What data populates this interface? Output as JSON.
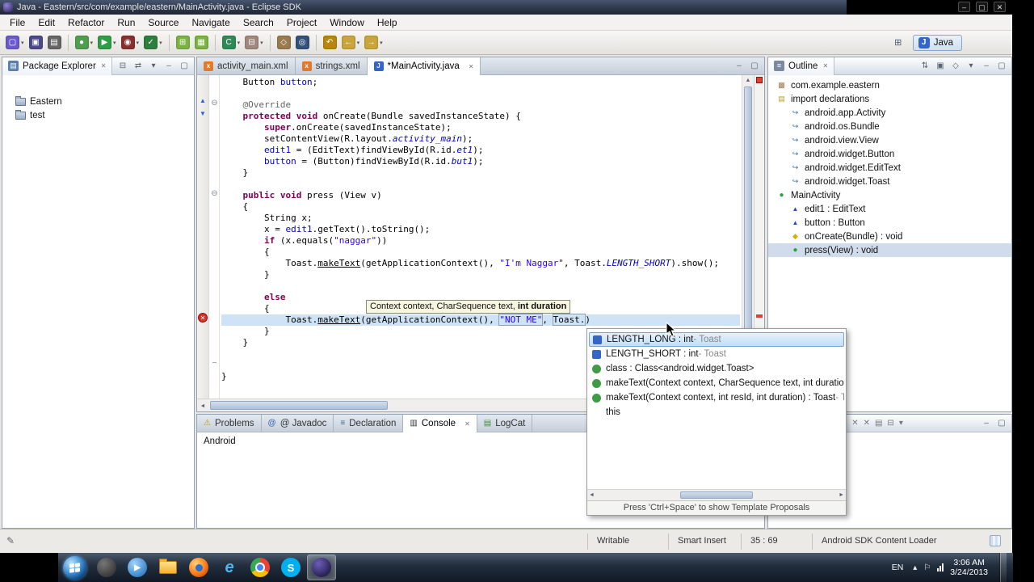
{
  "icons": {
    "minimize": "–",
    "maximize": "▢",
    "close": "✕",
    "view_close": "✕",
    "panel_min": "–",
    "panel_max": "▢",
    "view_menu": "▾",
    "collapse_all": "⊟",
    "link_with_editor": "⇄",
    "sort": "⇅",
    "hide_fields": "▣",
    "hide_static": "◇",
    "fold_collapse": "⊖",
    "fold_end": "−",
    "error": "✕",
    "scroll_left": "◄",
    "scroll_right": "►",
    "scroll_up": "▲",
    "scroll_down": "▼",
    "package_explorer_view": "▤",
    "outline_view": "≡",
    "tray_hidden": "▴",
    "tray_flag": "⚐",
    "pencil": "✎"
  },
  "window": {
    "title": "Java - Eastern/src/com/example/eastern/MainActivity.java - Eclipse SDK"
  },
  "menu_bar": {
    "items": [
      "File",
      "Edit",
      "Refactor",
      "Run",
      "Source",
      "Navigate",
      "Search",
      "Project",
      "Window",
      "Help"
    ]
  },
  "toolbar": {
    "buttons": [
      {
        "name": "new-wizard",
        "glyph": "▢",
        "tint": "#6a5acd",
        "dd": true
      },
      {
        "name": "save",
        "glyph": "▣",
        "tint": "#4a4a8a",
        "dd": false
      },
      {
        "name": "print",
        "glyph": "▤",
        "tint": "#666666",
        "dd": false
      },
      {
        "name": "sep"
      },
      {
        "name": "debug",
        "glyph": "●",
        "tint": "#4f9e4f",
        "dd": true
      },
      {
        "name": "run",
        "glyph": "▶",
        "tint": "#2f9e44",
        "dd": true
      },
      {
        "name": "run-history",
        "glyph": "◉",
        "tint": "#8a2f2f",
        "dd": true
      },
      {
        "name": "external-tools",
        "glyph": "✓",
        "tint": "#2f7e3e",
        "dd": true
      },
      {
        "name": "sep"
      },
      {
        "name": "android-sdk-manager",
        "glyph": "⊞",
        "tint": "#7cb342",
        "dd": false
      },
      {
        "name": "avd-manager",
        "glyph": "▦",
        "tint": "#7cb342",
        "dd": false
      },
      {
        "name": "sep"
      },
      {
        "name": "new-java-class",
        "glyph": "C",
        "tint": "#2e8b57",
        "dd": true
      },
      {
        "name": "new-java-package",
        "glyph": "⊟",
        "tint": "#a1887f",
        "dd": true
      },
      {
        "name": "sep"
      },
      {
        "name": "open-type",
        "glyph": "◇",
        "tint": "#9a7b4f",
        "dd": false
      },
      {
        "name": "search",
        "glyph": "◎",
        "tint": "#33527a",
        "dd": false
      },
      {
        "name": "sep"
      },
      {
        "name": "last-edit-location",
        "glyph": "↶",
        "tint": "#b8860b",
        "dd": false
      },
      {
        "name": "back",
        "glyph": "←",
        "tint": "#caa53d",
        "dd": true
      },
      {
        "name": "forward",
        "glyph": "→",
        "tint": "#caa53d",
        "dd": true
      }
    ],
    "open_perspective_icon": "⊞",
    "perspective_icon": "J",
    "perspective_label": "Java"
  },
  "package_explorer": {
    "title": "Package Explorer",
    "items": [
      {
        "label": "Eastern"
      },
      {
        "label": "test"
      }
    ]
  },
  "editor": {
    "tabs": [
      {
        "label": "activity_main.xml",
        "icon": "xml",
        "active": false
      },
      {
        "label": "strings.xml",
        "icon": "xml",
        "active": false
      },
      {
        "label": "*MainActivity.java",
        "icon": "java",
        "active": true
      }
    ],
    "tooltip": {
      "plain": "Context context, CharSequence text, ",
      "bold": "int duration"
    },
    "lines": [
      {
        "s": [
          [
            "    Button ",
            "pln"
          ],
          [
            "button",
            "fld"
          ],
          [
            ";",
            "pln"
          ]
        ]
      },
      {
        "s": []
      },
      {
        "fold": "collapse",
        "s": [
          [
            "    ",
            "pln"
          ],
          [
            "@Override",
            "ann"
          ]
        ]
      },
      {
        "s": [
          [
            "    ",
            "pln"
          ],
          [
            "protected void ",
            "kw"
          ],
          [
            "onCreate(Bundle savedInstanceState) {",
            "pln"
          ]
        ]
      },
      {
        "s": [
          [
            "        ",
            "pln"
          ],
          [
            "super",
            "kw"
          ],
          [
            ".onCreate(savedInstanceState);",
            "pln"
          ]
        ]
      },
      {
        "s": [
          [
            "        setContentView(R.layout.",
            "pln"
          ],
          [
            "activity_main",
            "sfl"
          ],
          [
            ");",
            "pln"
          ]
        ]
      },
      {
        "s": [
          [
            "        ",
            "pln"
          ],
          [
            "edit1",
            "fld"
          ],
          [
            " = (EditText)findViewById(R.id.",
            "pln"
          ],
          [
            "et1",
            "sfl"
          ],
          [
            ");",
            "pln"
          ]
        ]
      },
      {
        "s": [
          [
            "        ",
            "pln"
          ],
          [
            "button",
            "fld"
          ],
          [
            " = (Button)findViewById(R.id.",
            "pln"
          ],
          [
            "but1",
            "sfl"
          ],
          [
            ");",
            "pln"
          ]
        ]
      },
      {
        "s": [
          [
            "    }",
            "pln"
          ]
        ]
      },
      {
        "s": []
      },
      {
        "fold": "collapse",
        "s": [
          [
            "    ",
            "pln"
          ],
          [
            "public void ",
            "kw"
          ],
          [
            "press (View v)",
            "pln"
          ]
        ]
      },
      {
        "s": [
          [
            "    {",
            "pln"
          ]
        ]
      },
      {
        "s": [
          [
            "        String x;",
            "pln"
          ]
        ]
      },
      {
        "s": [
          [
            "        x = ",
            "pln"
          ],
          [
            "edit1",
            "fld"
          ],
          [
            ".getText().toString();",
            "pln"
          ]
        ]
      },
      {
        "s": [
          [
            "        ",
            "pln"
          ],
          [
            "if",
            "kw"
          ],
          [
            " (x.equals(",
            "pln"
          ],
          [
            "\"naggar\"",
            "str"
          ],
          [
            "))",
            "pln"
          ]
        ]
      },
      {
        "s": [
          [
            "        {",
            "pln"
          ]
        ]
      },
      {
        "s": [
          [
            "            Toast.",
            "pln"
          ],
          [
            "makeText",
            "und"
          ],
          [
            "(getApplicationContext(), ",
            "pln"
          ],
          [
            "\"I'm Naggar\"",
            "str"
          ],
          [
            ", Toast.",
            "pln"
          ],
          [
            "LENGTH_SHORT",
            "sfl"
          ],
          [
            ").show();",
            "pln"
          ]
        ]
      },
      {
        "s": [
          [
            "        }",
            "pln"
          ]
        ]
      },
      {
        "s": []
      },
      {
        "s": [
          [
            "        ",
            "pln"
          ],
          [
            "else",
            "kw"
          ]
        ]
      },
      {
        "s": [
          [
            "        {",
            "pln"
          ]
        ]
      },
      {
        "hl": true,
        "s": [
          [
            "            Toast.",
            "pln"
          ],
          [
            "makeText",
            "und"
          ],
          [
            "(getApplicationContext(), ",
            "pln"
          ],
          [
            "\"NOT ME\"",
            "str boxed"
          ],
          [
            ", ",
            "pln"
          ],
          [
            "Toast.",
            "pln boxed"
          ],
          [
            ")",
            "pln"
          ]
        ]
      },
      {
        "s": [
          [
            "        }",
            "pln"
          ]
        ]
      },
      {
        "s": [
          [
            "    }",
            "pln"
          ]
        ]
      },
      {
        "s": []
      },
      {
        "fold": "end",
        "s": []
      },
      {
        "s": [
          [
            "}",
            "pln"
          ]
        ]
      }
    ]
  },
  "autocomplete": {
    "items": [
      {
        "icon": "field",
        "text": "LENGTH_LONG : int",
        "gray": " - Toast",
        "selected": true
      },
      {
        "icon": "field",
        "text": "LENGTH_SHORT : int",
        "gray": " - Toast",
        "selected": false
      },
      {
        "icon": "method",
        "text": "class : Class<android.widget.Toast>",
        "gray": "",
        "selected": false
      },
      {
        "icon": "method",
        "text": "makeText(Context context, CharSequence text, int duration) :",
        "gray": "",
        "selected": false
      },
      {
        "icon": "method",
        "text": "makeText(Context context, int resId, int duration) : Toast",
        "gray": " - Tc",
        "selected": false
      },
      {
        "icon": "none",
        "text": "this",
        "gray": "",
        "selected": false
      }
    ],
    "footer": "Press 'Ctrl+Space' to show Template Proposals"
  },
  "outline": {
    "title": "Outline",
    "items": [
      {
        "label": "com.example.eastern",
        "icon": "package",
        "indent": 0,
        "selected": false
      },
      {
        "label": "import declarations",
        "icon": "imports",
        "indent": 0,
        "selected": false
      },
      {
        "label": "android.app.Activity",
        "icon": "import",
        "indent": 1,
        "selected": false
      },
      {
        "label": "android.os.Bundle",
        "icon": "import",
        "indent": 1,
        "selected": false
      },
      {
        "label": "android.view.View",
        "icon": "import",
        "indent": 1,
        "selected": false
      },
      {
        "label": "android.widget.Button",
        "icon": "import",
        "indent": 1,
        "selected": false
      },
      {
        "label": "android.widget.EditText",
        "icon": "import",
        "indent": 1,
        "selected": false
      },
      {
        "label": "android.widget.Toast",
        "icon": "import",
        "indent": 1,
        "selected": false
      },
      {
        "label": "MainActivity",
        "icon": "class",
        "indent": 0,
        "selected": false
      },
      {
        "label": "edit1 : EditText",
        "icon": "field-default",
        "indent": 1,
        "selected": false
      },
      {
        "label": "button : Button",
        "icon": "field-default",
        "indent": 1,
        "selected": false
      },
      {
        "label": "onCreate(Bundle) : void",
        "icon": "method-protected",
        "indent": 1,
        "selected": false
      },
      {
        "label": "press(View) : void",
        "icon": "method-public",
        "indent": 1,
        "selected": true
      }
    ]
  },
  "bottom_panel": {
    "tabs": [
      {
        "label": "Problems",
        "glyph": "⚠",
        "tint": "#c79a00",
        "active": false,
        "closeable": false
      },
      {
        "label": "@ Javadoc",
        "glyph": "@",
        "tint": "#2a5db0",
        "active": false,
        "closeable": false
      },
      {
        "label": "Declaration",
        "glyph": "≡",
        "tint": "#44667f",
        "active": false,
        "closeable": false
      },
      {
        "label": "Console",
        "glyph": "▥",
        "tint": "#333333",
        "active": true,
        "closeable": true
      },
      {
        "label": "LogCat",
        "glyph": "▤",
        "tint": "#3a8f3a",
        "active": false,
        "closeable": false
      }
    ],
    "console_label": "Android"
  },
  "right_bottom_panel": {
    "toolbar": [
      {
        "name": "terminate",
        "glyph": "■",
        "tint": "#c05050"
      },
      {
        "name": "remove-launch",
        "glyph": "✕",
        "tint": "#777777"
      },
      {
        "name": "remove-all-launches",
        "glyph": "✕",
        "tint": "#777777"
      },
      {
        "name": "clear-console",
        "glyph": "▤",
        "tint": "#777777"
      },
      {
        "name": "scroll-lock",
        "glyph": "⊟",
        "tint": "#777777"
      },
      {
        "name": "pin-console",
        "glyph": "▾",
        "tint": "#777777"
      }
    ]
  },
  "status_bar": {
    "writable": "Writable",
    "insert_mode": "Smart Insert",
    "caret_position": "35 : 69",
    "loader": "Android SDK Content Loader"
  },
  "taskbar": {
    "apps": [
      {
        "name": "app-dark",
        "glyph": "",
        "active": false
      },
      {
        "name": "media-player",
        "glyph": "▶",
        "active": false
      },
      {
        "name": "windows-explorer",
        "glyph": "",
        "active": false
      },
      {
        "name": "firefox",
        "glyph": "",
        "active": false
      },
      {
        "name": "internet-explorer",
        "glyph": "e",
        "active": false
      },
      {
        "name": "chrome",
        "glyph": "",
        "active": false
      },
      {
        "name": "skype",
        "glyph": "S",
        "active": false
      },
      {
        "name": "eclipse",
        "glyph": "",
        "active": true
      }
    ],
    "tray": {
      "language": "EN",
      "time": "3:06 AM",
      "date": "3/24/2013"
    }
  }
}
